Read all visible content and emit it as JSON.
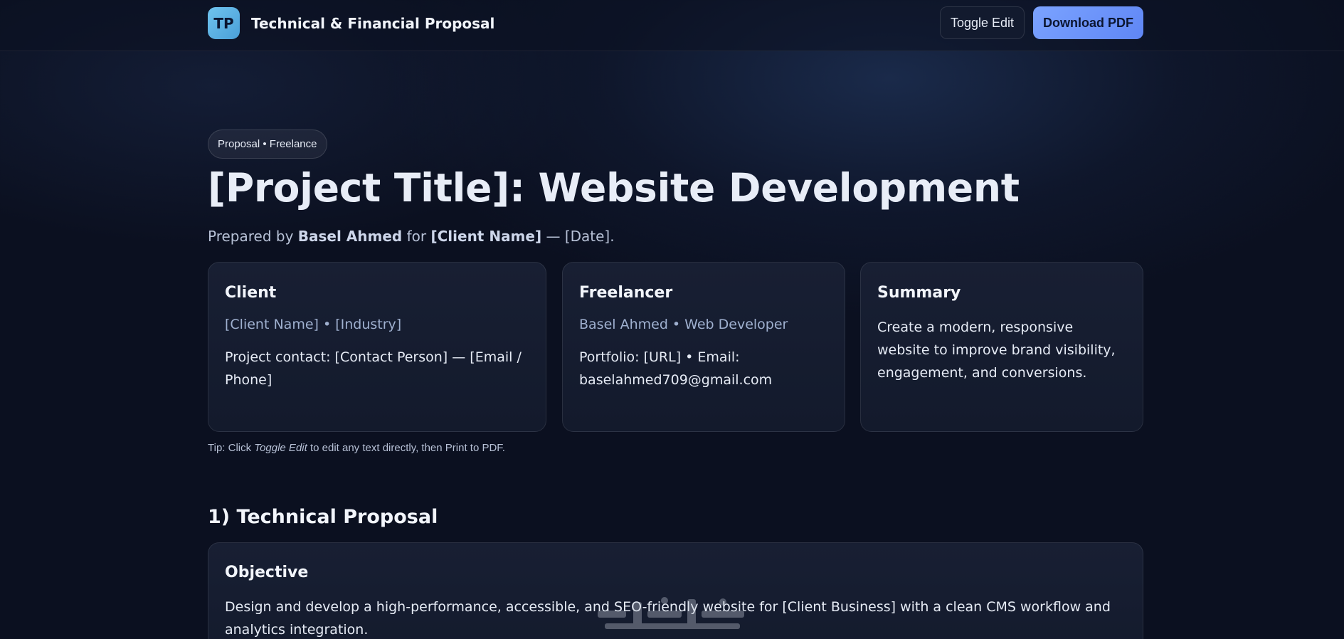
{
  "header": {
    "logo_text": "TP",
    "title": "Technical & Financial Proposal",
    "toggle_edit_label": "Toggle Edit",
    "download_pdf_label": "Download PDF"
  },
  "hero": {
    "pill": "Proposal • Freelance",
    "title": "[Project Title]: Website Development",
    "sub_prefix": "Prepared by ",
    "sub_author": "Basel Ahmed",
    "sub_mid": " for ",
    "sub_client": "[Client Name]",
    "sub_suffix": " — [Date]."
  },
  "cards": {
    "client": {
      "title": "Client",
      "meta": "[Client Name] • [Industry]",
      "body": "Project contact: [Contact Person] — [Email / Phone]"
    },
    "freelancer": {
      "title": "Freelancer",
      "meta": "Basel Ahmed • Web Developer",
      "body": "Portfolio: [URL] • Email: baselahmed709@gmail.com"
    },
    "summary": {
      "title": "Summary",
      "body": "Create a modern, responsive website to improve brand visibility, engagement, and conversions."
    }
  },
  "tip": {
    "prefix": "Tip: Click ",
    "emphasis": "Toggle Edit",
    "suffix": " to edit any text directly, then Print to PDF."
  },
  "technical": {
    "section_title": "1) Technical Proposal",
    "objective_title": "Objective",
    "objective_body": "Design and develop a high-performance, accessible, and SEO-friendly website for [Client Business] with a clean CMS workflow and analytics integration."
  },
  "colors": {
    "background": "#0b1020",
    "accent": "#6f96fb",
    "logo": "#5fb4e6"
  }
}
